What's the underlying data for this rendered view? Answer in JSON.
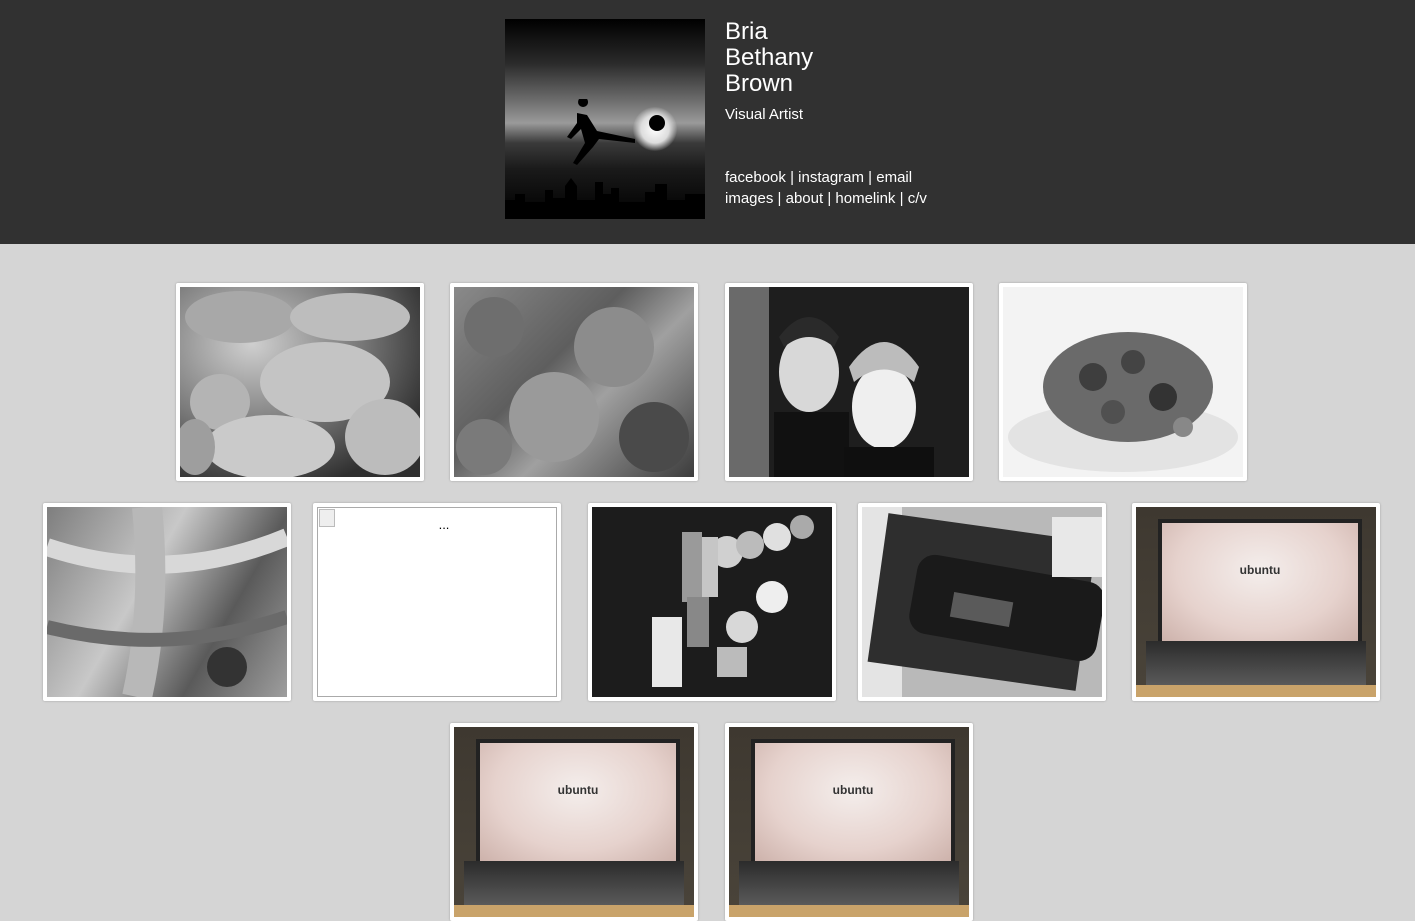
{
  "profile": {
    "name_first": "Bria",
    "name_middle": "Bethany",
    "name_last": "Brown",
    "role": "Visual Artist",
    "social_links": [
      "facebook",
      "instagram",
      "email"
    ],
    "nav_links": [
      "images",
      "about",
      "homelink",
      "c/v"
    ],
    "separator": "|"
  },
  "gallery": {
    "broken_alt": "...",
    "ubuntu_label": "ubuntu",
    "items": [
      "bread-loaves",
      "leaf-texture",
      "couple-portrait",
      "salad-plate",
      "wood-texture",
      "broken-image",
      "bar-signs-wall",
      "sony-walkman",
      "ubuntu-laptop",
      "ubuntu-laptop",
      "ubuntu-laptop"
    ]
  },
  "colors": {
    "header_bg": "#313131",
    "page_bg": "#d5d5d5",
    "frame": "#ffffff"
  }
}
